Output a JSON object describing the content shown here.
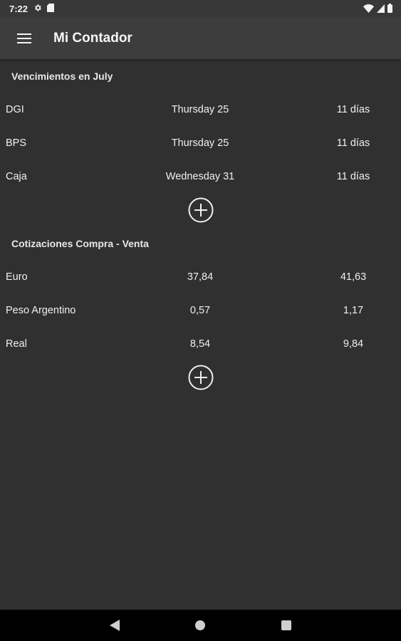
{
  "status_bar": {
    "time": "7:22",
    "icons": [
      "settings-icon",
      "sd-card-icon",
      "wifi-icon",
      "signal-icon",
      "battery-icon"
    ]
  },
  "app_bar": {
    "title": "Mi Contador",
    "menu_icon": "hamburger-menu-icon"
  },
  "due_dates": {
    "header": "Vencimientos en July",
    "rows": [
      {
        "name": "DGI",
        "date": "Thursday 25",
        "days": "11 días"
      },
      {
        "name": "BPS",
        "date": "Thursday 25",
        "days": "11 días"
      },
      {
        "name": "Caja",
        "date": "Wednesday 31",
        "days": "11 días"
      }
    ],
    "add_icon": "add-circle-icon"
  },
  "exchange_rates": {
    "header": "Cotizaciones Compra - Venta",
    "rows": [
      {
        "currency": "Euro",
        "buy": "37,84",
        "sell": "41,63"
      },
      {
        "currency": "Peso Argentino",
        "buy": "0,57",
        "sell": "1,17"
      },
      {
        "currency": "Real",
        "buy": "8,54",
        "sell": "9,84"
      }
    ],
    "add_icon": "add-circle-icon"
  },
  "nav_bar": {
    "buttons": [
      "back-icon",
      "home-icon",
      "recents-icon"
    ]
  },
  "colors": {
    "background": "#303030",
    "app_bar": "#3d3d3d",
    "status_bar": "#383838",
    "nav_bar": "#000000",
    "text": "#f0f0f0"
  }
}
